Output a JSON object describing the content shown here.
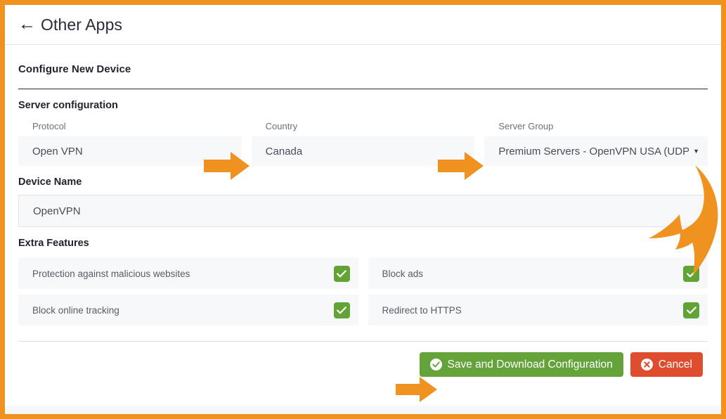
{
  "window": {
    "border_color": "#F0921F"
  },
  "header": {
    "back_icon": "back-arrow-icon",
    "title": "Other Apps"
  },
  "page": {
    "title": "Configure New Device"
  },
  "server_configuration": {
    "heading": "Server configuration",
    "fields": [
      {
        "label": "Protocol",
        "value": "Open VPN",
        "has_caret": false
      },
      {
        "label": "Country",
        "value": "Canada",
        "has_caret": false
      },
      {
        "label": "Server Group",
        "value": "Premium Servers - OpenVPN USA (UDP)",
        "has_caret": true,
        "caret_glyph": "▼"
      }
    ]
  },
  "device_name": {
    "heading": "Device Name",
    "value": "OpenVPN"
  },
  "extra_features": {
    "heading": "Extra Features",
    "items": [
      {
        "label": "Protection against malicious websites",
        "checked": true
      },
      {
        "label": "Block ads",
        "checked": true
      },
      {
        "label": "Block online tracking",
        "checked": true
      },
      {
        "label": "Redirect to HTTPS",
        "checked": true
      }
    ],
    "checkbox_color": "#61A334",
    "check_glyph": "check-icon"
  },
  "actions": {
    "save_label": "Save and Download Configuration",
    "save_icon": "check-circle-icon",
    "save_color": "#63A33A",
    "cancel_label": "Cancel",
    "cancel_icon": "x-circle-icon",
    "cancel_color": "#DD4D2E"
  },
  "annotations": {
    "color": "#F0921F",
    "arrows": [
      {
        "name": "arrow-to-country",
        "type": "straight-right"
      },
      {
        "name": "arrow-to-server-group",
        "type": "straight-right"
      },
      {
        "name": "arrow-to-device-name",
        "type": "curved-down-left"
      },
      {
        "name": "arrow-to-save-button",
        "type": "straight-right"
      }
    ]
  }
}
